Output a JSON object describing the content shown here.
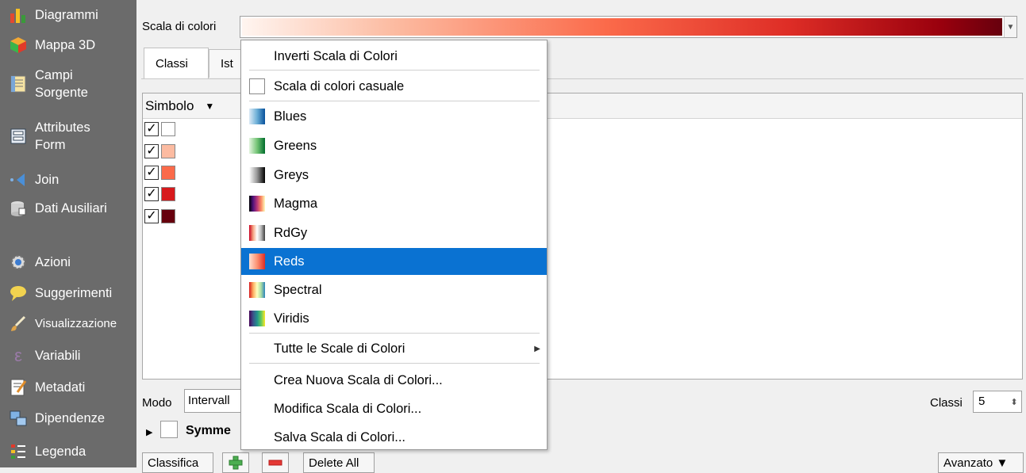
{
  "sidebar": {
    "items": [
      {
        "label": "Diagrammi",
        "icon": "diagram-icon"
      },
      {
        "label": "Mappa 3D",
        "icon": "cube-icon"
      },
      {
        "label": "Campi Sorgente",
        "icon": "fields-icon"
      },
      {
        "label": "Attributes Form",
        "icon": "form-icon"
      },
      {
        "label": "Join",
        "icon": "join-icon"
      },
      {
        "label": "Dati Ausiliari",
        "icon": "database-icon"
      },
      {
        "label": "Azioni",
        "icon": "gear-icon"
      },
      {
        "label": "Suggerimenti",
        "icon": "speech-bubble-icon"
      },
      {
        "label": "Visualizzazione",
        "icon": "brush-icon"
      },
      {
        "label": "Variabili",
        "icon": "epsilon-icon"
      },
      {
        "label": "Metadati",
        "icon": "metadata-icon"
      },
      {
        "label": "Dipendenze",
        "icon": "dependencies-icon"
      },
      {
        "label": "Legenda",
        "icon": "legend-icon"
      }
    ]
  },
  "main": {
    "scale_label": "Scala di colori",
    "tabs": [
      {
        "label": "Classi"
      },
      {
        "label": "Ist"
      }
    ],
    "list": {
      "header_symbol": "Simbolo",
      "rows": [
        {
          "checked": "✓",
          "color": "#ffffff"
        },
        {
          "checked": "✓",
          "color": "#fcbba1"
        },
        {
          "checked": "✓",
          "color": "#fb6a4a"
        },
        {
          "checked": "✓",
          "color": "#d7191c"
        },
        {
          "checked": "✓",
          "color": "#67000d"
        }
      ]
    },
    "modo_label": "Modo",
    "modo_value": "Intervall",
    "classi_label": "Classi",
    "classi_value": "5",
    "symmetric_label": "Symme",
    "buttons": {
      "classifica": "Classifica",
      "delete_all": "Delete All",
      "avanzato": "Avanzato ▼"
    }
  },
  "menu": {
    "invert": "Inverti Scala di Colori",
    "random": "Scala di colori casuale",
    "ramps": [
      {
        "label": "Blues",
        "gradient": "linear-gradient(to right,#deebf7,#6baed6,#08519c)"
      },
      {
        "label": "Greens",
        "gradient": "linear-gradient(to right,#e5f5e0,#74c476,#006d2c)"
      },
      {
        "label": "Greys",
        "gradient": "linear-gradient(to right,#ffffff,#969696,#000000)"
      },
      {
        "label": "Magma",
        "gradient": "linear-gradient(to right,#000004,#51127c,#b73779,#fc8961,#fcfdbf)"
      },
      {
        "label": "RdGy",
        "gradient": "linear-gradient(to right,#ca0020,#f4a582,#ffffff,#bababa,#404040)"
      },
      {
        "label": "Reds",
        "gradient": "linear-gradient(to right,#fee0d2,#fc9272,#de2d26)"
      },
      {
        "label": "Spectral",
        "gradient": "linear-gradient(to right,#d7191c,#fdae61,#ffffbf,#abdda4,#2b83ba)"
      },
      {
        "label": "Viridis",
        "gradient": "linear-gradient(to right,#440154,#3b528b,#21918c,#5ec962,#fde725)"
      }
    ],
    "selected": "Reds",
    "all_ramps": "Tutte le Scale di Colori",
    "create": "Crea Nuova Scala di Colori...",
    "edit": "Modifica Scala di Colori...",
    "save": "Salva Scala di Colori..."
  },
  "colors": {
    "sidebar_bg": "#6b6b6b",
    "selection": "#0a72d2"
  }
}
